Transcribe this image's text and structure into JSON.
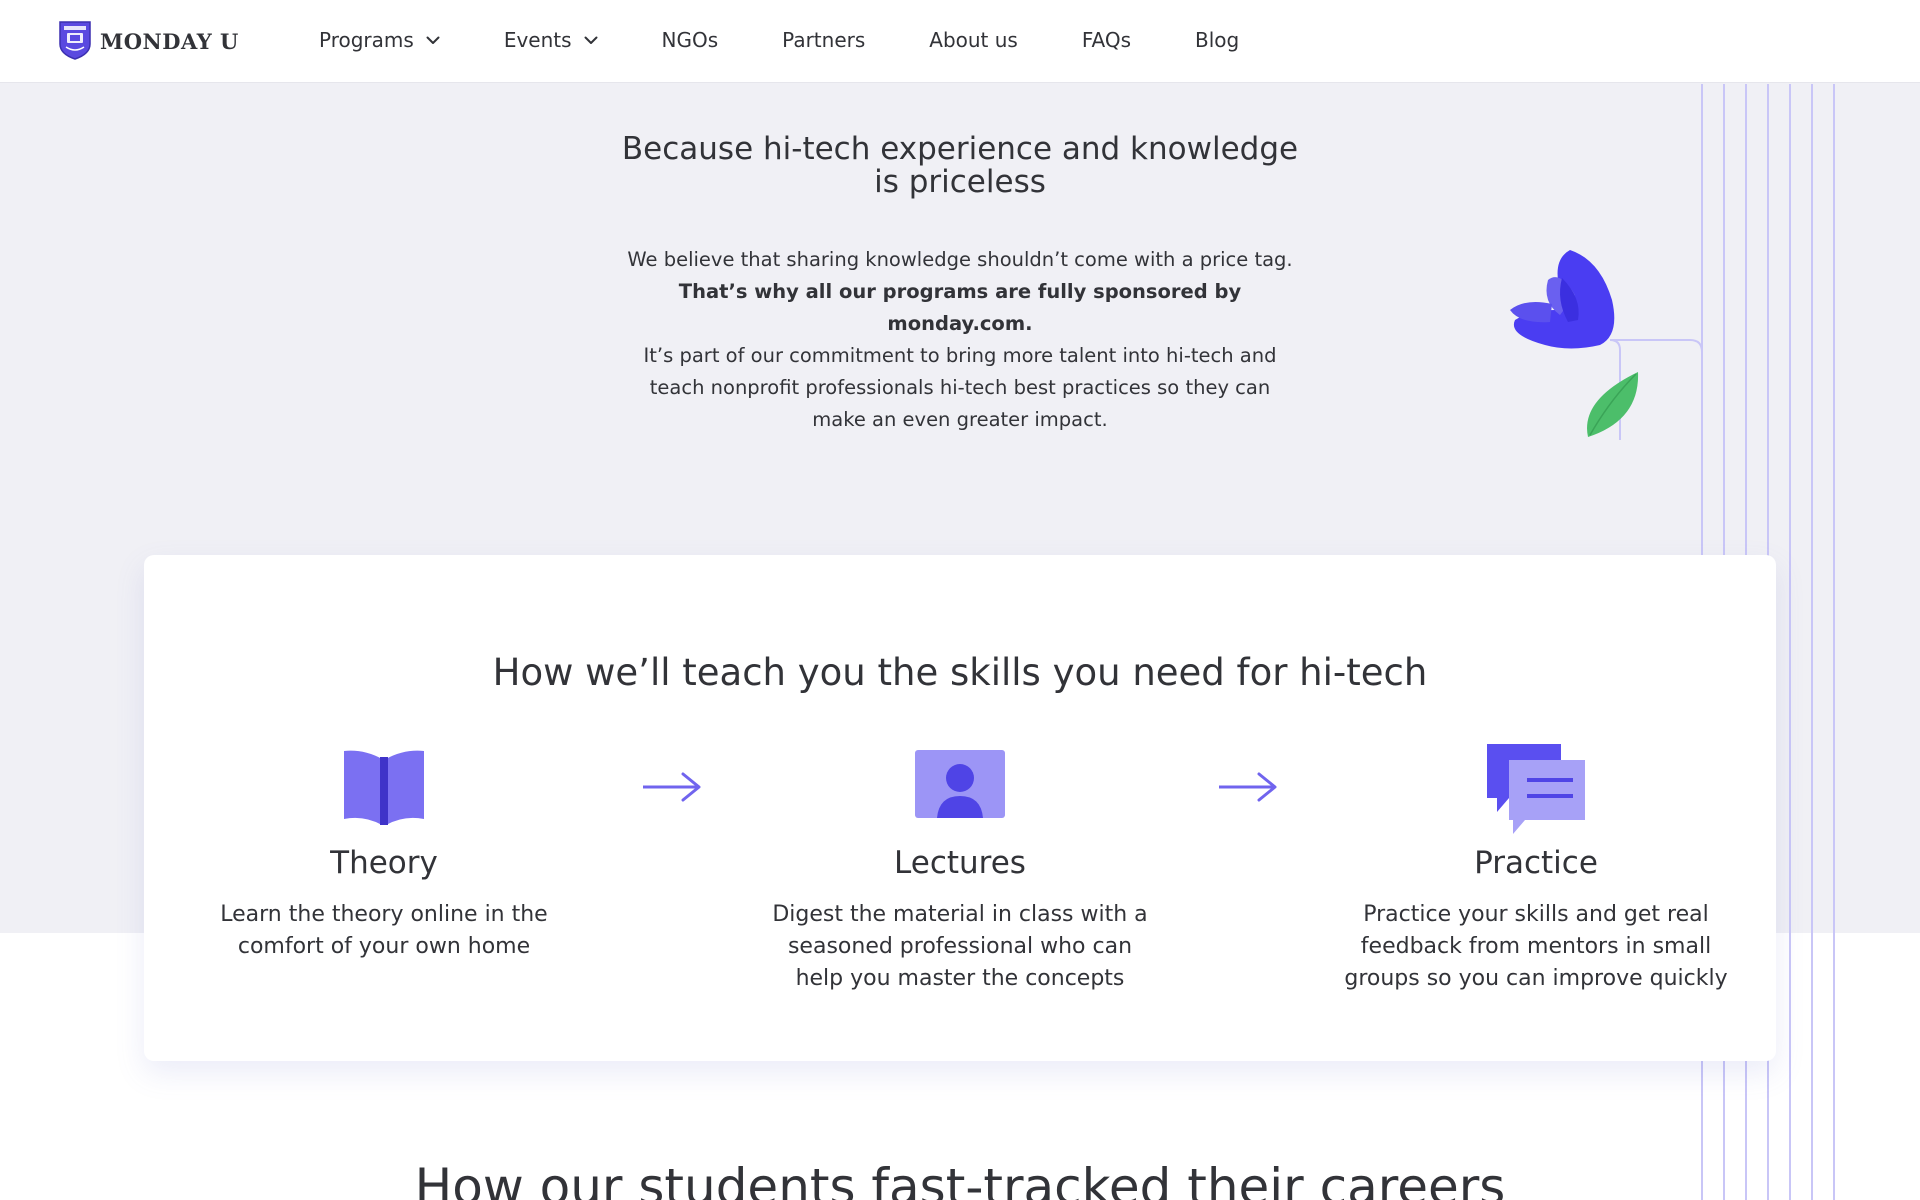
{
  "brand": {
    "logo_text": "MONDAY U",
    "accent": "#5034ff",
    "accent_light": "#8a84f5",
    "leaf": "#48c069"
  },
  "nav": {
    "items": [
      {
        "label": "Programs",
        "dropdown": true
      },
      {
        "label": "Events",
        "dropdown": true
      },
      {
        "label": "NGOs",
        "dropdown": false
      },
      {
        "label": "Partners",
        "dropdown": false
      },
      {
        "label": "About us",
        "dropdown": false
      },
      {
        "label": "FAQs",
        "dropdown": false
      },
      {
        "label": "Blog",
        "dropdown": false
      }
    ]
  },
  "intro": {
    "title_line1": "Because hi-tech experience and knowledge",
    "title_line2": "is priceless",
    "body_line1": "We believe that sharing knowledge shouldn’t come with a price tag.",
    "body_strong": "That’s why all our programs are fully sponsored by monday.com.",
    "body_line3": "It’s part of our commitment to bring more talent into hi-tech and",
    "body_line4": "teach nonprofit professionals hi-tech best practices so they can",
    "body_line5": "make an even greater impact."
  },
  "teach": {
    "title": "How we’ll teach you the skills you need for hi-tech",
    "steps": [
      {
        "title": "Theory",
        "icon": "open-book-icon",
        "desc_line1": "Learn the theory online in the",
        "desc_line2": "comfort of your own home",
        "desc_line3": ""
      },
      {
        "title": "Lectures",
        "icon": "presenter-screen-icon",
        "desc_line1": "Digest the material in class with a",
        "desc_line2": "seasoned professional who can",
        "desc_line3": "help you master the concepts"
      },
      {
        "title": "Practice",
        "icon": "chat-bubbles-icon",
        "desc_line1": "Practice your skills and get real",
        "desc_line2": "feedback from mentors in small",
        "desc_line3": "groups so you can improve quickly"
      }
    ]
  },
  "next_section": {
    "title": "How our students fast-tracked their careers"
  }
}
